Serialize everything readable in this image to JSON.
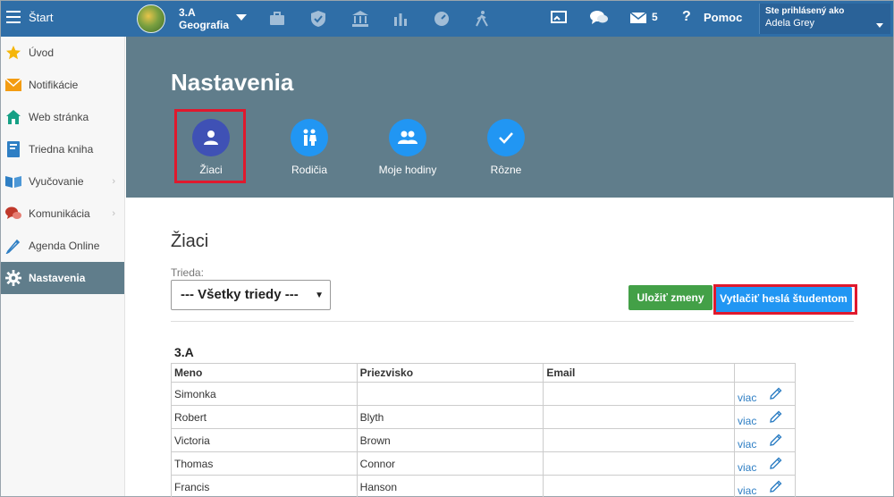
{
  "topbar": {
    "start_label": "Štart",
    "class_name": "3.A",
    "subject": "Geografia",
    "nav_icons": [
      "briefcase-icon",
      "shield-icon",
      "bank-icon",
      "bar-chart-icon",
      "speedometer-icon",
      "hiking-icon"
    ],
    "message_count": "5",
    "help_label": "Pomoc",
    "user_caption": "Ste prihlásený ako",
    "user_name": "Adela Grey"
  },
  "sidebar": {
    "items": [
      {
        "label": "Úvod",
        "icon": "star-icon",
        "color": "#f5b60a"
      },
      {
        "label": "Notifikácie",
        "icon": "envelope-icon",
        "color": "#f39c12"
      },
      {
        "label": "Web stránka",
        "icon": "house-icon",
        "color": "#16a085"
      },
      {
        "label": "Triedna kniha",
        "icon": "book-icon",
        "color": "#2f7fc4"
      },
      {
        "label": "Vyučovanie",
        "icon": "open-book-icon",
        "color": "#2f7fc4"
      },
      {
        "label": "Komunikácia",
        "icon": "chat-bubbles-icon",
        "color": "#c0392b"
      },
      {
        "label": "Agenda Online",
        "icon": "pen-icon",
        "color": "#2f7fc4"
      },
      {
        "label": "Nastavenia",
        "icon": "gear-icon",
        "color": "#ffffff"
      }
    ]
  },
  "header": {
    "title": "Nastavenia",
    "tabs": [
      {
        "label": "Žiaci",
        "icon": "person-icon"
      },
      {
        "label": "Rodičia",
        "icon": "parents-icon"
      },
      {
        "label": "Moje hodiny",
        "icon": "group-icon"
      },
      {
        "label": "Rôzne",
        "icon": "check-icon"
      }
    ]
  },
  "main": {
    "section_title": "Žiaci",
    "class_label": "Trieda:",
    "class_select_value": "--- Všetky triedy ---",
    "save_button": "Uložiť zmeny",
    "print_button": "Vytlačiť heslá študentom",
    "group_title": "3.A",
    "columns": [
      "Meno",
      "Priezvisko",
      "Email",
      ""
    ],
    "more_label": "viac",
    "rows": [
      {
        "first": "Simonka",
        "last": "",
        "email": ""
      },
      {
        "first": "Robert",
        "last": "Blyth",
        "email": ""
      },
      {
        "first": "Victoria",
        "last": "Brown",
        "email": ""
      },
      {
        "first": "Thomas",
        "last": "Connor",
        "email": ""
      },
      {
        "first": "Francis",
        "last": "Hanson",
        "email": ""
      }
    ]
  },
  "colors": {
    "topbar": "#2f6ea7",
    "band": "#607d8b",
    "accent": "#2196f3",
    "selected_tab": "#3f51b5",
    "highlight": "#e0192d",
    "save_green": "#43a047"
  }
}
